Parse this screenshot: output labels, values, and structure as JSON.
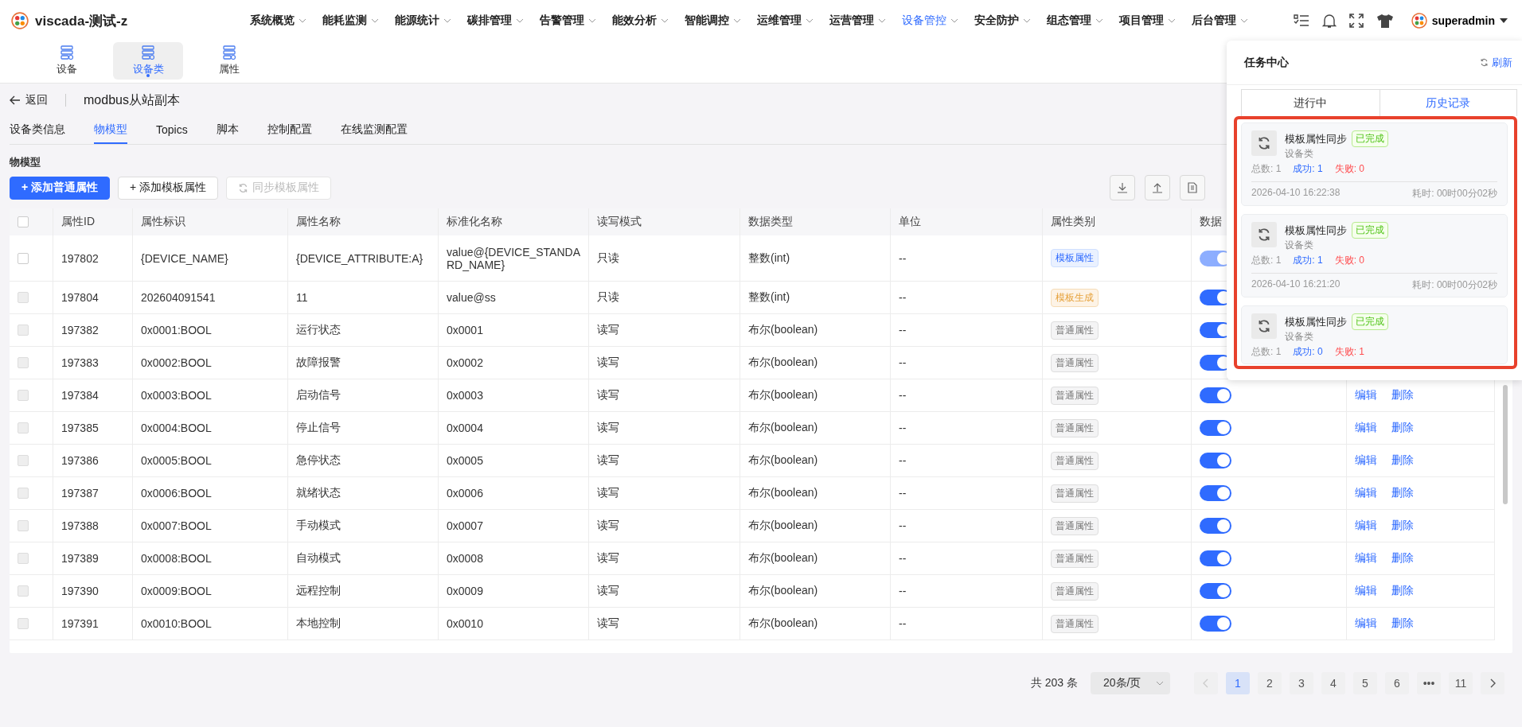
{
  "app": {
    "title": "viscada-测试-z"
  },
  "nav": [
    {
      "label": "系统概览",
      "selected": false
    },
    {
      "label": "能耗监测",
      "selected": false
    },
    {
      "label": "能源统计",
      "selected": false
    },
    {
      "label": "碳排管理",
      "selected": false
    },
    {
      "label": "告警管理",
      "selected": false
    },
    {
      "label": "能效分析",
      "selected": false
    },
    {
      "label": "智能调控",
      "selected": false
    },
    {
      "label": "运维管理",
      "selected": false
    },
    {
      "label": "运营管理",
      "selected": false
    },
    {
      "label": "设备管控",
      "selected": true
    },
    {
      "label": "安全防护",
      "selected": false
    },
    {
      "label": "组态管理",
      "selected": false
    },
    {
      "label": "项目管理",
      "selected": false
    },
    {
      "label": "后台管理",
      "selected": false
    }
  ],
  "user": {
    "name": "superadmin"
  },
  "subnav": [
    {
      "label": "设备",
      "selected": false
    },
    {
      "label": "设备类",
      "selected": true
    },
    {
      "label": "属性",
      "selected": false
    }
  ],
  "back": {
    "label": "返回"
  },
  "page_title": "modbus从站副本",
  "tabs": [
    {
      "label": "设备类信息",
      "selected": false
    },
    {
      "label": "物模型",
      "selected": true
    },
    {
      "label": "Topics",
      "selected": false
    },
    {
      "label": "脚本",
      "selected": false
    },
    {
      "label": "控制配置",
      "selected": false
    },
    {
      "label": "在线监测配置",
      "selected": false
    }
  ],
  "section_title": "物模型",
  "buttons": [
    {
      "label": "+ 添加普通属性",
      "kind": "primary",
      "disabled": false
    },
    {
      "label": "+ 添加模板属性",
      "kind": "default",
      "disabled": false
    },
    {
      "label": "同步模板属性",
      "kind": "sync",
      "disabled": true
    }
  ],
  "table": {
    "header_checked": false,
    "columns": [
      "属性ID",
      "属性标识",
      "属性名称",
      "标准化名称",
      "读写模式",
      "数据类型",
      "单位",
      "属性类别",
      "数据"
    ],
    "rows": [
      {
        "checkbox_disabled": false,
        "checked": false,
        "id": "197802",
        "identifier": "{DEVICE_NAME}",
        "name": "{DEVICE_ATTRIBUTE:A}",
        "std_name": "value@{DEVICE_STANDARD_NAME}",
        "rw": "只读",
        "type": "整数(int)",
        "unit": "--",
        "category": {
          "label": "模板属性",
          "kind": "template"
        },
        "enabled": {
          "on": true,
          "disabled": true
        }
      },
      {
        "checkbox_disabled": true,
        "checked": false,
        "id": "197804",
        "identifier": "202604091541",
        "name": "11",
        "std_name": "value@ss",
        "rw": "只读",
        "type": "整数(int)",
        "unit": "--",
        "category": {
          "label": "模板生成",
          "kind": "generated"
        },
        "enabled": {
          "on": true,
          "disabled": false
        }
      },
      {
        "checkbox_disabled": true,
        "checked": false,
        "id": "197382",
        "identifier": "0x0001:BOOL",
        "name": "运行状态",
        "std_name": "0x0001",
        "rw": "读写",
        "type": "布尔(boolean)",
        "unit": "--",
        "category": {
          "label": "普通属性",
          "kind": "normal"
        },
        "enabled": {
          "on": true,
          "disabled": false
        }
      },
      {
        "checkbox_disabled": true,
        "checked": false,
        "id": "197383",
        "identifier": "0x0002:BOOL",
        "name": "故障报警",
        "std_name": "0x0002",
        "rw": "读写",
        "type": "布尔(boolean)",
        "unit": "--",
        "category": {
          "label": "普通属性",
          "kind": "normal"
        },
        "enabled": {
          "on": true,
          "disabled": false
        }
      },
      {
        "checkbox_disabled": true,
        "checked": false,
        "id": "197384",
        "identifier": "0x0003:BOOL",
        "name": "启动信号",
        "std_name": "0x0003",
        "rw": "读写",
        "type": "布尔(boolean)",
        "unit": "--",
        "category": {
          "label": "普通属性",
          "kind": "normal"
        },
        "enabled": {
          "on": true,
          "disabled": false
        },
        "actions": [
          "编辑",
          "删除"
        ]
      },
      {
        "checkbox_disabled": true,
        "checked": false,
        "id": "197385",
        "identifier": "0x0004:BOOL",
        "name": "停止信号",
        "std_name": "0x0004",
        "rw": "读写",
        "type": "布尔(boolean)",
        "unit": "--",
        "category": {
          "label": "普通属性",
          "kind": "normal"
        },
        "enabled": {
          "on": true,
          "disabled": false
        },
        "actions": [
          "编辑",
          "删除"
        ]
      },
      {
        "checkbox_disabled": true,
        "checked": false,
        "id": "197386",
        "identifier": "0x0005:BOOL",
        "name": "急停状态",
        "std_name": "0x0005",
        "rw": "读写",
        "type": "布尔(boolean)",
        "unit": "--",
        "category": {
          "label": "普通属性",
          "kind": "normal"
        },
        "enabled": {
          "on": true,
          "disabled": false
        },
        "actions": [
          "编辑",
          "删除"
        ]
      },
      {
        "checkbox_disabled": true,
        "checked": false,
        "id": "197387",
        "identifier": "0x0006:BOOL",
        "name": "就绪状态",
        "std_name": "0x0006",
        "rw": "读写",
        "type": "布尔(boolean)",
        "unit": "--",
        "category": {
          "label": "普通属性",
          "kind": "normal"
        },
        "enabled": {
          "on": true,
          "disabled": false
        },
        "actions": [
          "编辑",
          "删除"
        ]
      },
      {
        "checkbox_disabled": true,
        "checked": false,
        "id": "197388",
        "identifier": "0x0007:BOOL",
        "name": "手动模式",
        "std_name": "0x0007",
        "rw": "读写",
        "type": "布尔(boolean)",
        "unit": "--",
        "category": {
          "label": "普通属性",
          "kind": "normal"
        },
        "enabled": {
          "on": true,
          "disabled": false
        },
        "actions": [
          "编辑",
          "删除"
        ]
      },
      {
        "checkbox_disabled": true,
        "checked": false,
        "id": "197389",
        "identifier": "0x0008:BOOL",
        "name": "自动模式",
        "std_name": "0x0008",
        "rw": "读写",
        "type": "布尔(boolean)",
        "unit": "--",
        "category": {
          "label": "普通属性",
          "kind": "normal"
        },
        "enabled": {
          "on": true,
          "disabled": false
        },
        "actions": [
          "编辑",
          "删除"
        ]
      },
      {
        "checkbox_disabled": true,
        "checked": false,
        "id": "197390",
        "identifier": "0x0009:BOOL",
        "name": "远程控制",
        "std_name": "0x0009",
        "rw": "读写",
        "type": "布尔(boolean)",
        "unit": "--",
        "category": {
          "label": "普通属性",
          "kind": "normal"
        },
        "enabled": {
          "on": true,
          "disabled": false
        },
        "actions": [
          "编辑",
          "删除"
        ]
      },
      {
        "checkbox_disabled": true,
        "checked": false,
        "id": "197391",
        "identifier": "0x0010:BOOL",
        "name": "本地控制",
        "std_name": "0x0010",
        "rw": "读写",
        "type": "布尔(boolean)",
        "unit": "--",
        "category": {
          "label": "普通属性",
          "kind": "normal"
        },
        "enabled": {
          "on": true,
          "disabled": false
        },
        "actions": [
          "编辑",
          "删除"
        ]
      }
    ]
  },
  "pagination": {
    "total": "共 203 条",
    "page_size": "20条/页",
    "prev_disabled": true,
    "pages": [
      {
        "label": "1",
        "selected": true
      },
      {
        "label": "2",
        "selected": false
      },
      {
        "label": "3",
        "selected": false
      },
      {
        "label": "4",
        "selected": false
      },
      {
        "label": "5",
        "selected": false
      },
      {
        "label": "6",
        "selected": false
      },
      {
        "label": "•••",
        "selected": false
      },
      {
        "label": "11",
        "selected": false
      }
    ]
  },
  "task_center": {
    "title": "任务中心",
    "refresh": "刷新",
    "tabs": [
      {
        "label": "进行中",
        "selected": false
      },
      {
        "label": "历史记录",
        "selected": true
      }
    ],
    "highlighted": true,
    "tasks": [
      {
        "title": "模板属性同步",
        "status": "已完成",
        "subtitle": "设备类",
        "total": "总数: 1",
        "success": "成功: 1",
        "fail": "失败: 0",
        "time": "2026-04-10 16:22:38",
        "duration": "耗时: 00时00分02秒"
      },
      {
        "title": "模板属性同步",
        "status": "已完成",
        "subtitle": "设备类",
        "total": "总数: 1",
        "success": "成功: 1",
        "fail": "失败: 0",
        "time": "2026-04-10 16:21:20",
        "duration": "耗时: 00时00分02秒"
      },
      {
        "title": "模板属性同步",
        "status": "已完成",
        "subtitle": "设备类",
        "total": "总数: 1",
        "success": "成功: 0",
        "fail": "失败: 1"
      }
    ]
  }
}
